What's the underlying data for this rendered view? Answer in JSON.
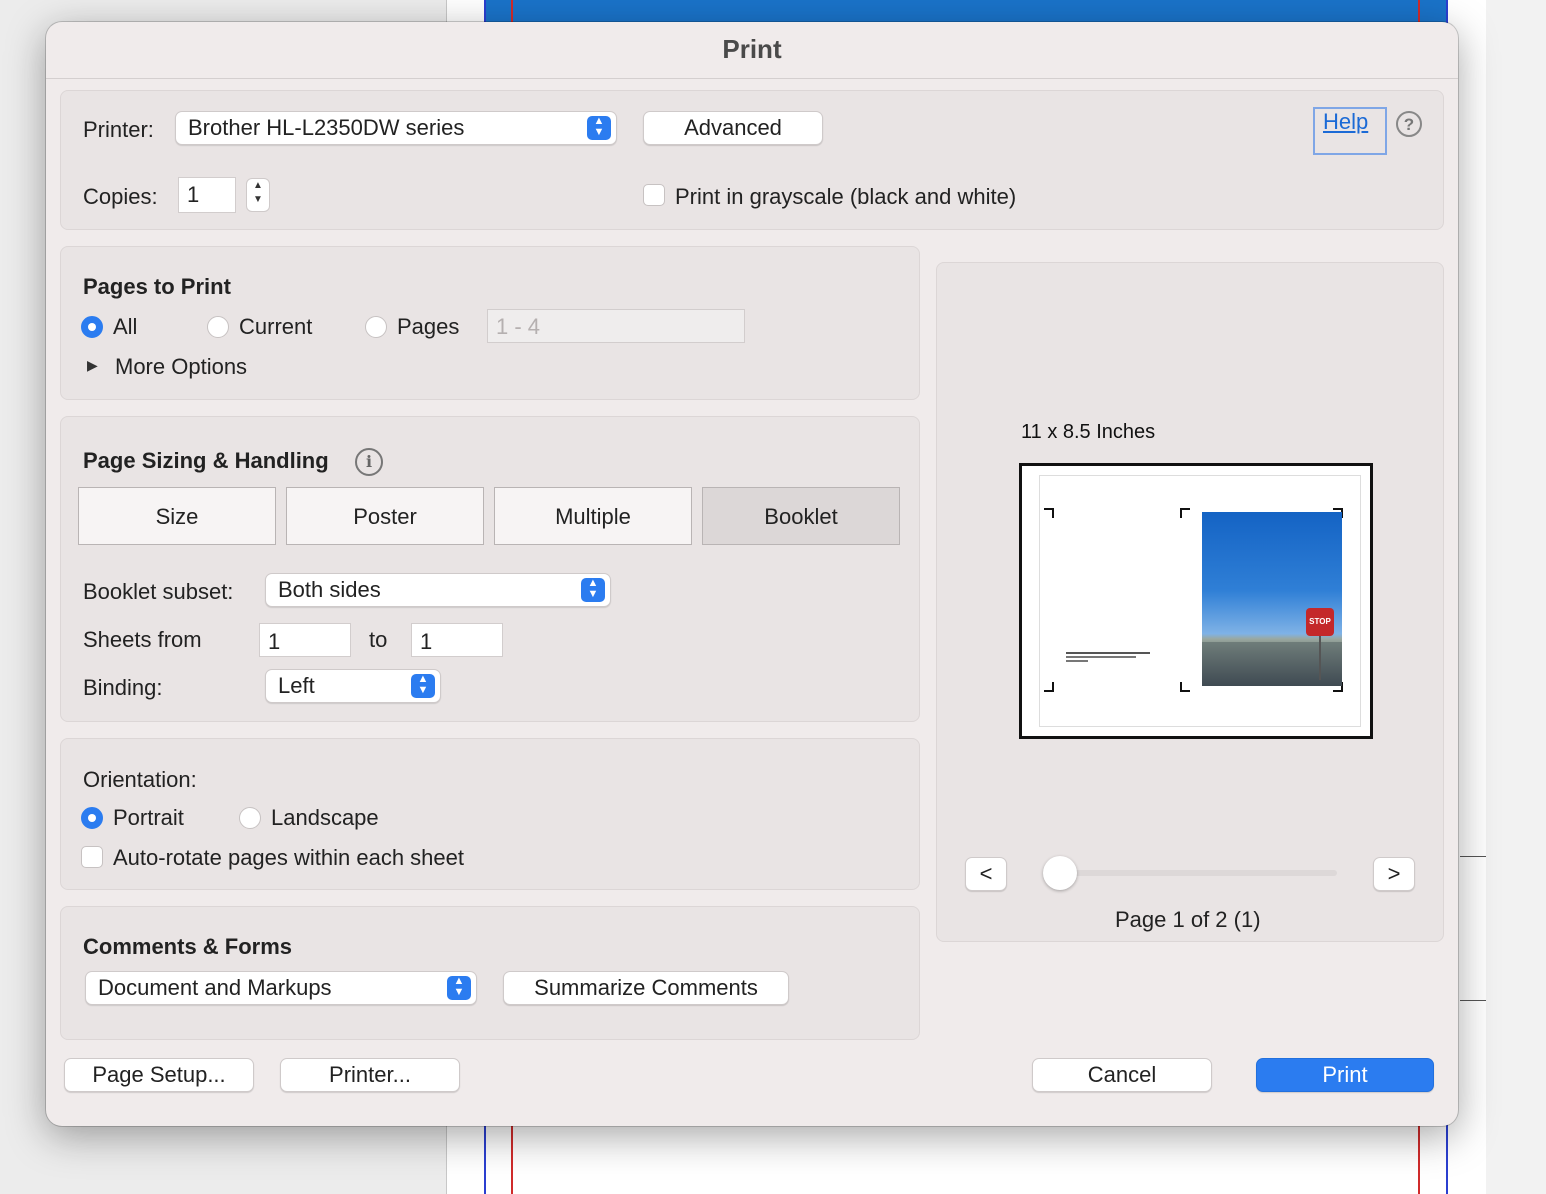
{
  "dialog": {
    "title": "Print"
  },
  "printer": {
    "label": "Printer:",
    "selected": "Brother HL-L2350DW series",
    "advanced_label": "Advanced",
    "help_label": "Help",
    "copies_label": "Copies:",
    "copies_value": "1",
    "grayscale_label": "Print in grayscale (black and white)",
    "grayscale_checked": false
  },
  "pages_to_print": {
    "heading": "Pages to Print",
    "options": [
      "All",
      "Current",
      "Pages"
    ],
    "selected": "All",
    "range_placeholder": "1 - 4",
    "more_options_label": "More Options"
  },
  "page_sizing": {
    "heading": "Page Sizing & Handling",
    "tabs": [
      "Size",
      "Poster",
      "Multiple",
      "Booklet"
    ],
    "selected_tab": "Booklet",
    "booklet_subset_label": "Booklet subset:",
    "booklet_subset_value": "Both sides",
    "sheets_from_label": "Sheets from",
    "sheets_from_value": "1",
    "sheets_to_label": "to",
    "sheets_to_value": "1",
    "binding_label": "Binding:",
    "binding_value": "Left"
  },
  "orientation": {
    "heading": "Orientation:",
    "options": [
      "Portrait",
      "Landscape"
    ],
    "selected": "Portrait",
    "autorotate_label": "Auto-rotate pages within each sheet",
    "autorotate_checked": false
  },
  "comments_forms": {
    "heading": "Comments & Forms",
    "selected": "Document and Markups",
    "summarize_label": "Summarize Comments"
  },
  "preview": {
    "paper_size": "11 x 8.5 Inches",
    "prev_label": "<",
    "next_label": ">",
    "page_status": "Page 1 of 2 (1)",
    "slider_position": 0,
    "sign_text": "STOP"
  },
  "footer": {
    "page_setup_label": "Page Setup...",
    "printer_label": "Printer...",
    "cancel_label": "Cancel",
    "print_label": "Print"
  },
  "colors": {
    "accent": "#2b7cf0",
    "link": "#1b6ad6",
    "print_button": "#2b7cf0"
  }
}
